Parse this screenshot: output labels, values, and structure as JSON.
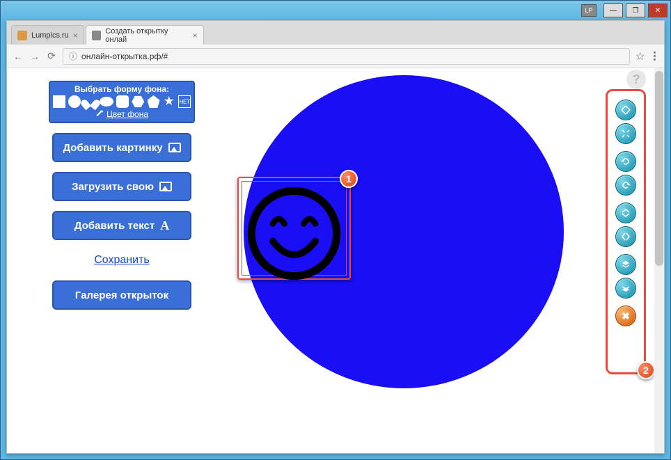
{
  "window": {
    "lp": "LP"
  },
  "tabs": [
    {
      "title": "Lumpics.ru"
    },
    {
      "title": "Создать открытку онлай"
    }
  ],
  "address": {
    "url": "онлайн-открытка.рф/#"
  },
  "shape_panel": {
    "title": "Выбрать форму фона:",
    "none_label": "НЕТ",
    "bg_color_label": "Цвет фона"
  },
  "buttons": {
    "add_image": "Добавить картинку",
    "upload_own": "Загрузить свою",
    "add_text": "Добавить текст",
    "save": "Сохранить",
    "gallery": "Галерея открыток"
  },
  "callouts": {
    "one": "1",
    "two": "2"
  },
  "help": "?",
  "tools": {
    "zoom_in": "zoom-in",
    "zoom_out": "zoom-out",
    "rotate_ccw": "rotate-ccw",
    "rotate_cw": "rotate-cw",
    "flip_v": "flip-v",
    "flip_h": "flip-h",
    "layer_up": "layer-up",
    "layer_down": "layer-down",
    "delete": "delete"
  },
  "colors": {
    "bg_shape": "#1a0ef5",
    "accent": "#3a6fd8",
    "highlight": "#e74c3c"
  }
}
